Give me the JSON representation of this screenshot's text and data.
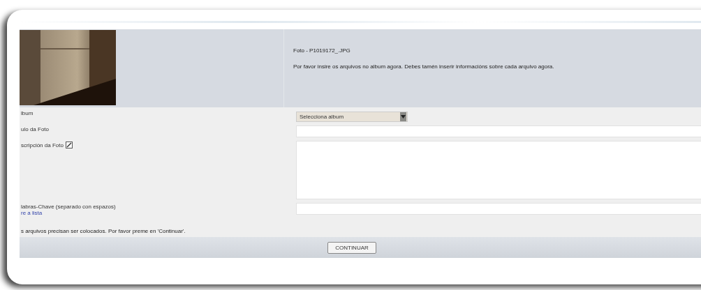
{
  "header": {
    "file_title": "Foto - P1019172_.JPG",
    "instructions": "Por favor insire os arquivos no album agora. Debes tamén inserir informacións sobre cada arquivo agora."
  },
  "form": {
    "rows": [
      {
        "kind": "select",
        "label": "lbum",
        "value": "Selecciona album"
      },
      {
        "kind": "input",
        "label": "ulo da Foto"
      },
      {
        "kind": "textarea",
        "label": "scripción da Foto",
        "edit_icon": true
      },
      {
        "kind": "input",
        "label": "labras-Chave (separado con espazos)",
        "link": "re a lista"
      }
    ]
  },
  "message": "s arquivos precisan ser colocados. Por favor preme en 'Continuar'.",
  "buttons": [
    "CONTINUAR"
  ]
}
